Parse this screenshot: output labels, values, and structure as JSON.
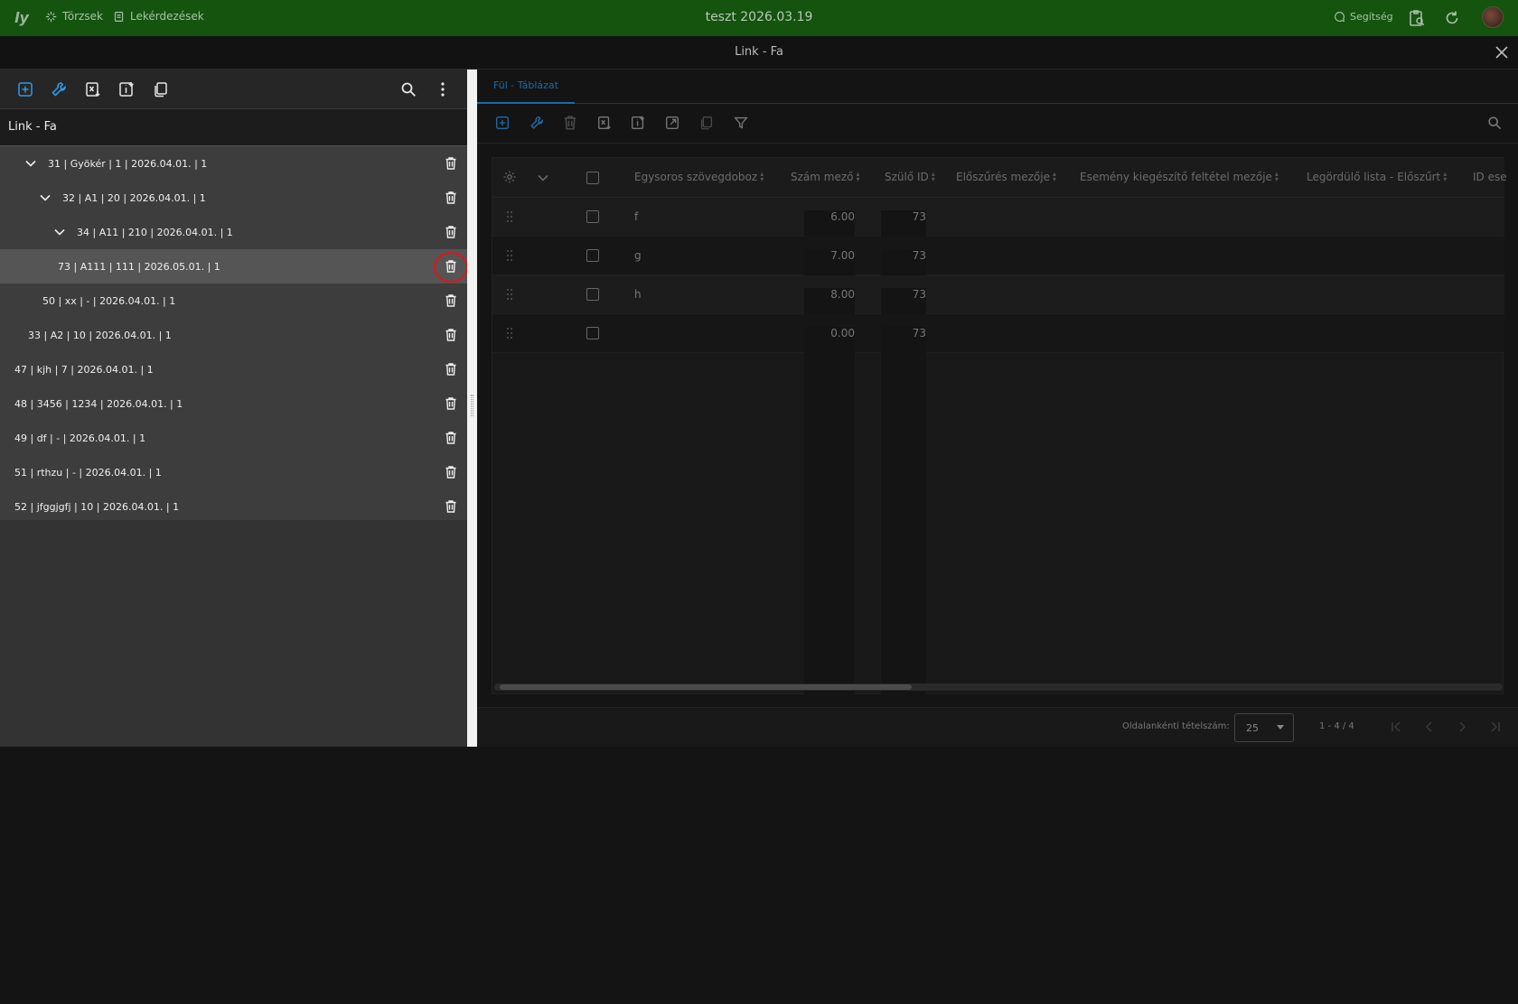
{
  "topbar": {
    "nav_items": [
      "Törzsek",
      "Lekérdezések"
    ],
    "title": "teszt 2026.03.19",
    "help_label": "Segítség"
  },
  "dialog": {
    "title": "Link - Fa"
  },
  "left_panel": {
    "title": "Link - Fa",
    "tree": [
      {
        "label": "31 | Gyökér | 1 | 2026.04.01. | 1",
        "expanded": true
      },
      {
        "label": "32 | A1 | 20 | 2026.04.01. | 1",
        "expanded": true
      },
      {
        "label": "34 | A11 | 210 | 2026.04.01. | 1",
        "expanded": true
      },
      {
        "label": "73 | A111 | 111 | 2026.05.01. | 1",
        "selected": true
      },
      {
        "label": "50 | xx | - | 2026.04.01. | 1"
      },
      {
        "label": "33 | A2 | 10 | 2026.04.01. | 1"
      },
      {
        "label": "47 | kjh | 7 | 2026.04.01. | 1"
      },
      {
        "label": "48 | 3456 | 1234 | 2026.04.01. | 1"
      },
      {
        "label": "49 | df | - | 2026.04.01. | 1"
      },
      {
        "label": "51 | rthzu | - | 2026.04.01. | 1"
      },
      {
        "label": "52 | jfggjgfj | 10 | 2026.04.01. | 1"
      }
    ]
  },
  "right_panel": {
    "tab_label": "Fül - Táblázat",
    "columns": [
      "Egysoros szövegdoboz",
      "Szám mező",
      "Szülő ID",
      "Előszűrés mezője",
      "Esemény kiegészítő feltétel mezője",
      "Legördülő lista - Előszűrt",
      "ID ese"
    ],
    "rows": [
      {
        "text": "f",
        "number": "6.00",
        "parent_id": "73"
      },
      {
        "text": "g",
        "number": "7.00",
        "parent_id": "73"
      },
      {
        "text": "h",
        "number": "8.00",
        "parent_id": "73"
      },
      {
        "text": "",
        "number": "0.00",
        "parent_id": "73"
      }
    ],
    "pager": {
      "page_size_label": "Oldalankénti tételszám:",
      "page_size": "25",
      "range": "1 - 4 / 4"
    }
  },
  "colors": {
    "topbar": "#14540f",
    "accent": "#2e9ae6",
    "highlight_ring": "#e0141a"
  }
}
